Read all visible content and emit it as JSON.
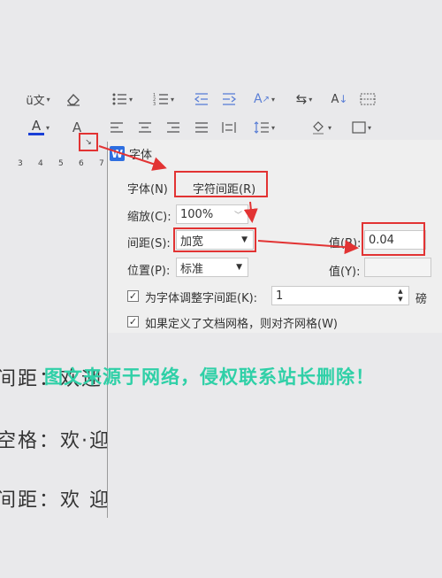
{
  "toolbar": {
    "row1": [
      "pinyin-guide-icon",
      "eraser-icon",
      "bullet-list-icon",
      "numbered-list-icon",
      "decrease-indent-icon",
      "increase-indent-icon",
      "text-direction-icon",
      "line-break-icon",
      "sort-icon",
      "table-borders-icon"
    ],
    "row2": [
      "font-color-icon",
      "char-shading-icon",
      "align-left-icon",
      "align-center-icon",
      "align-right-icon",
      "justify-icon",
      "distributed-icon",
      "line-spacing-icon",
      "fill-color-icon",
      "border-icon"
    ],
    "font_color_glyph": "A",
    "shading_glyph": "A",
    "font_color_underline": "#1a3fd6"
  },
  "ruler": {
    "ticks": [
      "3",
      "4",
      "5",
      "6",
      "7"
    ]
  },
  "dialog": {
    "title": "字体",
    "logo": "W",
    "tab_font": "字体(N)",
    "tab_spacing": "字符间距(R)",
    "scale_label": "缩放(C):",
    "scale_value": "100%",
    "spacing_label": "间距(S):",
    "spacing_value": "加宽",
    "value_b_label": "值(B):",
    "value_b": "0.04",
    "position_label": "位置(P):",
    "position_value": "标准",
    "value_y_label": "值(Y):",
    "value_y": "",
    "kerning_checked": true,
    "kerning_label": "为字体调整字间距(K):",
    "kerning_value": "1",
    "kerning_unit": "磅",
    "snap_grid_checked": true,
    "snap_grid_label": "如果定义了文档网格，则对齐网格(W)"
  },
  "document": {
    "lines": [
      "间距：欢迎",
      "空格：欢·迎",
      "间距：欢 迎"
    ]
  },
  "watermark": "图文来源于网络，侵权联系站长删除！",
  "colors": {
    "annotation_red": "#e23333",
    "watermark": "#2fd0a7"
  }
}
